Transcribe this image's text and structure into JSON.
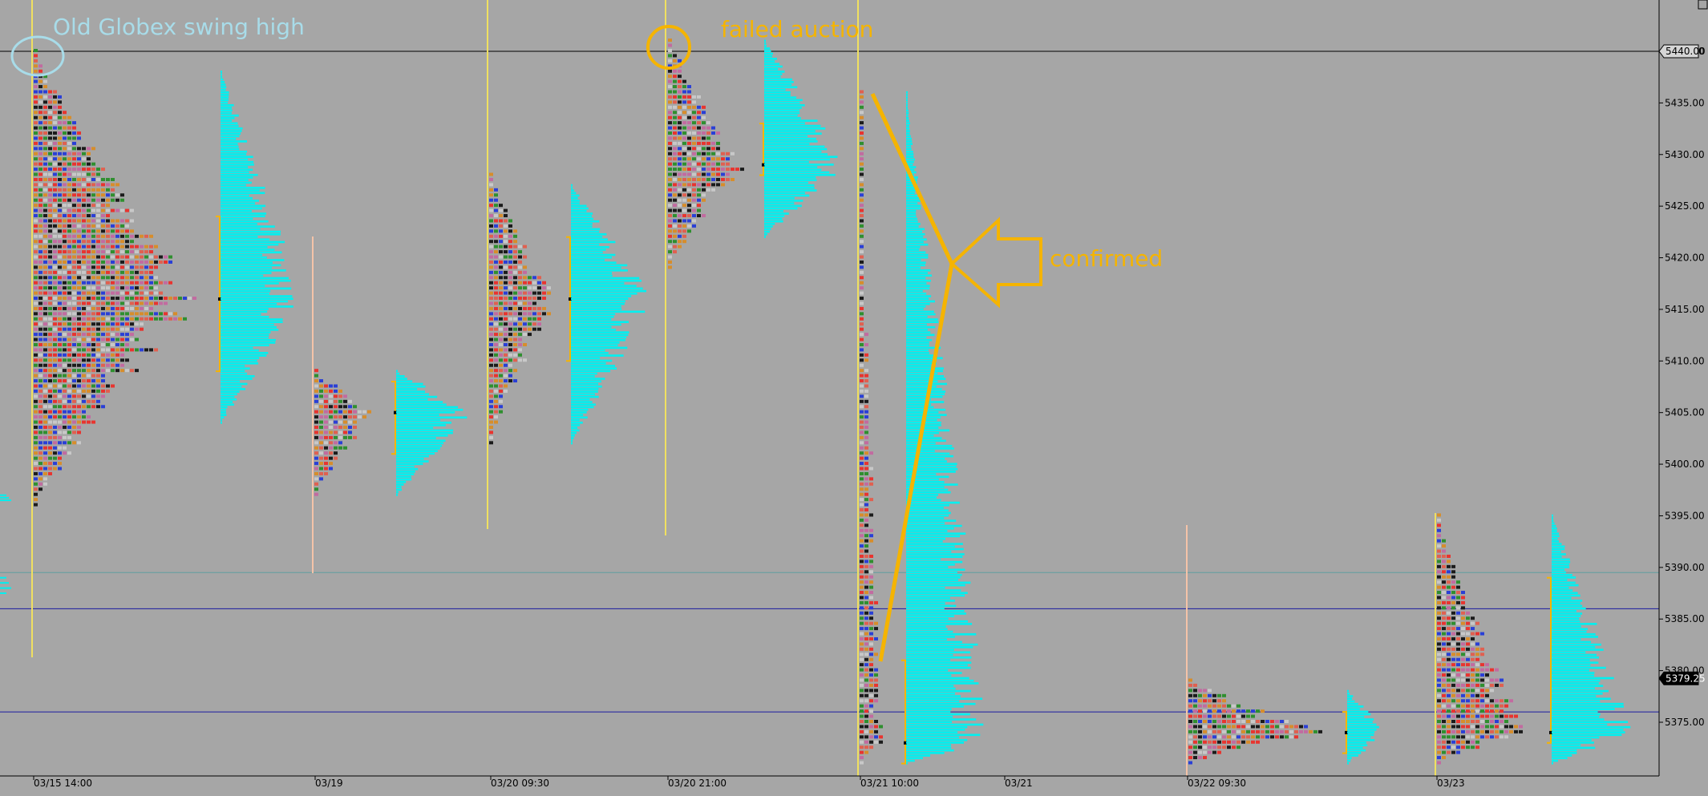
{
  "chart_data": {
    "type": "market-profile",
    "x_ticks": [
      "03/15 14:00",
      "03/19",
      "03/20 09:30",
      "03/20 21:00",
      "03/21 10:00",
      "03/21",
      "03/22 09:30",
      "03/23"
    ],
    "y_ticks": [
      "5440.00",
      "5435.00",
      "5430.00",
      "5425.00",
      "5420.00",
      "5415.00",
      "5410.00",
      "5405.00",
      "5400.00",
      "5395.00",
      "5390.00",
      "5385.00",
      "5380.00",
      "5375.00"
    ],
    "ylim": [
      5371,
      5445
    ],
    "price_flags": [
      {
        "label": "5440.00",
        "value": 5440,
        "style": "light"
      },
      {
        "label": "5379.25",
        "value": 5379.25,
        "style": "dark"
      }
    ],
    "horizontal_lines": [
      {
        "value": 5440,
        "color": "#000000"
      },
      {
        "value": 5389.5,
        "color": "#5f9ea0"
      },
      {
        "value": 5386,
        "color": "#1a1aa0"
      },
      {
        "value": 5376,
        "color": "#1a1aa0"
      }
    ],
    "sessions": [
      {
        "tpo_high": 5440,
        "tpo_low": 5396,
        "poc": 5416,
        "va_high": 5424,
        "va_low": 5409,
        "vol_high": 5438,
        "vol_low": 5404
      },
      {
        "tpo_high": 5409,
        "tpo_low": 5397,
        "poc": 5405,
        "va_high": 5408,
        "va_low": 5401,
        "vol_high": 5409,
        "vol_low": 5397
      },
      {
        "tpo_high": 5428,
        "tpo_low": 5402,
        "poc": 5416,
        "va_high": 5422,
        "va_low": 5410,
        "vol_high": 5427,
        "vol_low": 5402
      },
      {
        "tpo_high": 5441,
        "tpo_low": 5419,
        "poc": 5429,
        "va_high": 5433,
        "va_low": 5428,
        "vol_high": 5441,
        "vol_low": 5422
      },
      {
        "tpo_high": 5436,
        "tpo_low": 5371,
        "poc": 5373,
        "va_high": 5381,
        "va_low": 5371,
        "vol_high": 5436,
        "vol_low": 5371
      },
      {
        "tpo_high": 5379,
        "tpo_low": 5371,
        "poc": 5374,
        "va_high": 5376,
        "va_low": 5372,
        "vol_high": 5378,
        "vol_low": 5371
      },
      {
        "tpo_high": 5395,
        "tpo_low": 5371,
        "poc": 5374,
        "va_high": 5389,
        "va_low": 5373,
        "vol_high": 5395,
        "vol_low": 5371
      }
    ],
    "annotations": [
      {
        "text": "Old Globex swing high",
        "color": "#a8dce9"
      },
      {
        "text": "failed auction",
        "color": "#f5b400"
      },
      {
        "text": "confirmed",
        "color": "#f5b400"
      }
    ],
    "colors": {
      "background": "#a6a6a6",
      "volume_profile": "#00f0f0",
      "annotation": "#f5b400",
      "annotation_light": "#a8dce9"
    }
  }
}
